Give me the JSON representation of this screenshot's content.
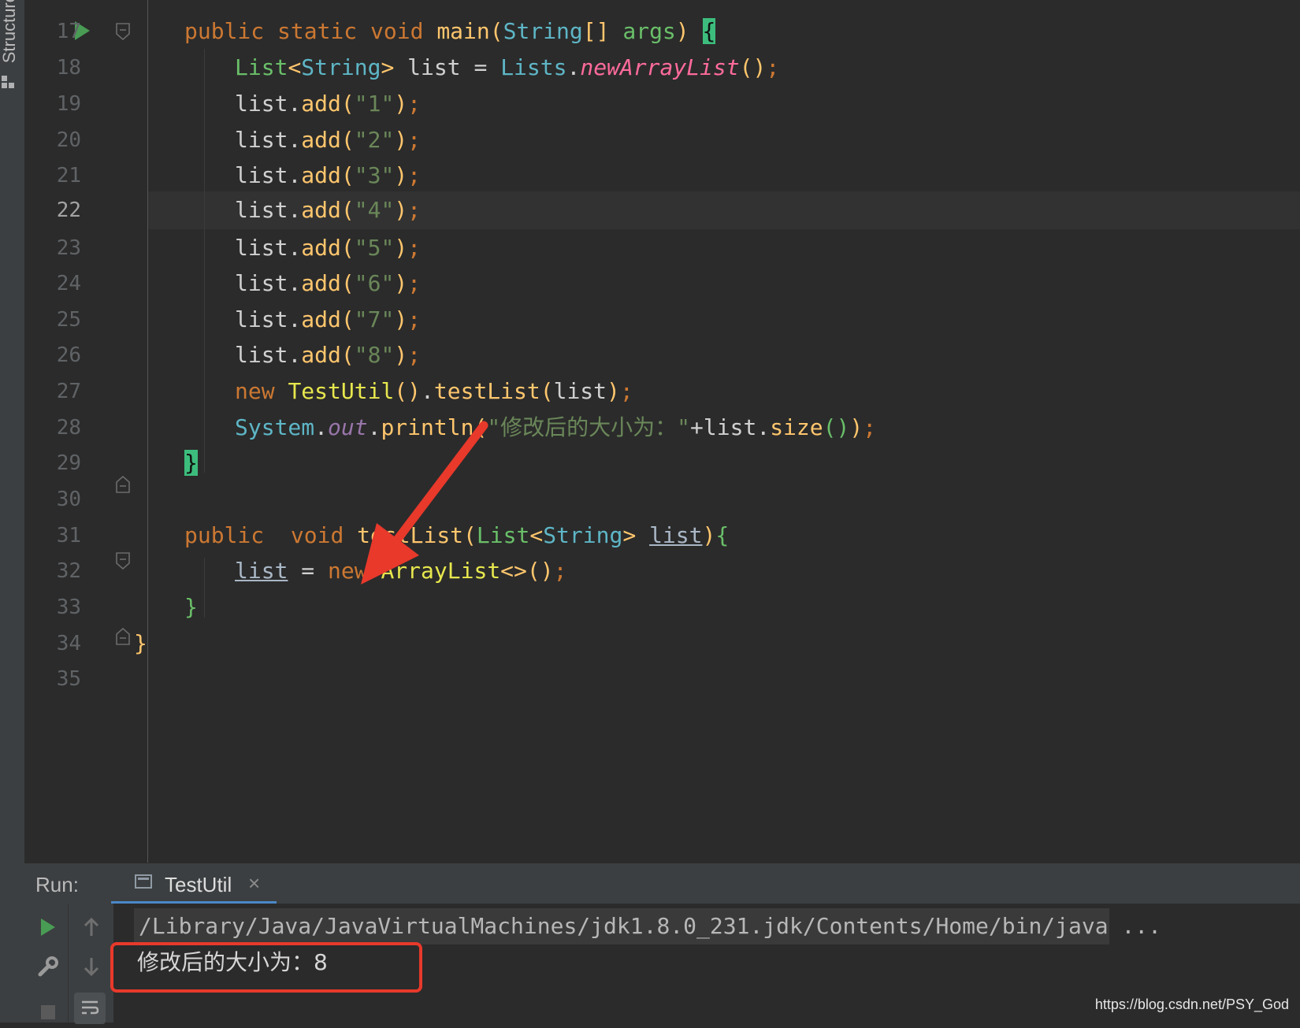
{
  "sidebar": {
    "structure_label": "Structure"
  },
  "editor": {
    "lines": [
      {
        "num": "17"
      },
      {
        "num": "18"
      },
      {
        "num": "19"
      },
      {
        "num": "20"
      },
      {
        "num": "21"
      },
      {
        "num": "22"
      },
      {
        "num": "23"
      },
      {
        "num": "24"
      },
      {
        "num": "25"
      },
      {
        "num": "26"
      },
      {
        "num": "27"
      },
      {
        "num": "28"
      },
      {
        "num": "29"
      },
      {
        "num": "30"
      },
      {
        "num": "31"
      },
      {
        "num": "32"
      },
      {
        "num": "33"
      },
      {
        "num": "34"
      },
      {
        "num": "35"
      }
    ],
    "tokens": {
      "public": "public",
      "static": "static",
      "void": "void",
      "main": "main",
      "String": "String",
      "arr": "[]",
      "args": "args",
      "open_paren": "(",
      "close_paren": ")",
      "lbrace": "{",
      "rbrace": "}",
      "List": "List",
      "lt": "<",
      "gt": ">",
      "list": "list",
      "eq": "=",
      "Lists": "Lists",
      "dot": ".",
      "newArrayList": "newArrayList",
      "semi": ";",
      "add": "add",
      "s1": "\"1\"",
      "s2": "\"2\"",
      "s3": "\"3\"",
      "s4": "\"4\"",
      "s5": "\"5\"",
      "s6": "\"6\"",
      "s7": "\"7\"",
      "s8": "\"8\"",
      "new": "new",
      "TestUtil": "TestUtil",
      "testList": "testList",
      "System": "System",
      "out": "out",
      "println": "println",
      "msg": "\"修改后的大小为：\"",
      "plus": "+",
      "size": "size",
      "testList_def": "testList",
      "ArrayList": "ArrayList",
      "diamond": "<>"
    }
  },
  "run_panel": {
    "label": "Run:",
    "tab": {
      "label": "TestUtil",
      "close": "×"
    },
    "command": "/Library/Java/JavaVirtualMachines/jdk1.8.0_231.jdk/Contents/Home/bin/java ...",
    "output": "修改后的大小为：8"
  },
  "watermark": "https://blog.csdn.net/PSY_God",
  "colors": {
    "accent_arrow": "#e8392b",
    "highlight_box": "#e8392b",
    "run_green": "#499c54"
  }
}
